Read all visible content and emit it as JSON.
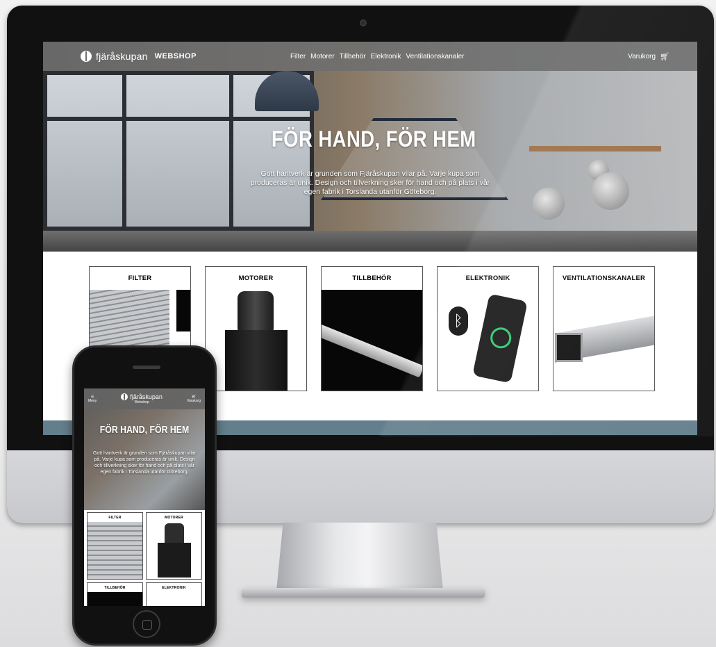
{
  "desktop": {
    "nav": {
      "brand": "fjäråskupan",
      "webshop": "WEBSHOP",
      "links": [
        "Filter",
        "Motorer",
        "Tillbehör",
        "Elektronik",
        "Ventilationskanaler"
      ],
      "cart_label": "Varukorg"
    },
    "hero": {
      "title": "FÖR HAND, FÖR HEM",
      "text": "Gott hantverk är grunden som Fjäråskupan vilar på. Varje kupa som produceras är unik. Design och tillverkning sker för hand och på plats i vår egen fabrik i Torslanda utanför Göteborg."
    },
    "categories": [
      "FILTER",
      "MOTORER",
      "TILLBEHÖR",
      "ELEKTRONIK",
      "VENTILATIONSKANALER"
    ]
  },
  "mobile": {
    "nav": {
      "menu_label": "Meny",
      "brand": "fjäråskupan",
      "sub": "Webshop",
      "cart_label": "Varukorg"
    },
    "hero": {
      "title": "FÖR HAND, FÖR HEM",
      "text": "Gott hantverk är grunden som Fjäråskupan vilar på. Varje kupa som produceras är unik. Design och tillverkning sker för hand och på plats i vår egen fabrik i Torslanda utanför Göteborg."
    },
    "categories": [
      "FILTER",
      "MOTORER",
      "TILLBEHÖR",
      "ELEKTRONIK"
    ]
  },
  "colors": {
    "nav_bg": "#6e6e6e",
    "strip": "#637e8c",
    "screen_bg": "#ffffff"
  }
}
